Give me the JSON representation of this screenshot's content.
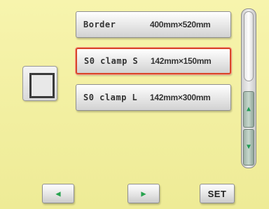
{
  "hoops": [
    {
      "name": "Border",
      "size": "400mm×520mm",
      "selected": false
    },
    {
      "name": "S0 clamp S",
      "size": "142mm×150mm",
      "selected": true
    },
    {
      "name": "S0 clamp L",
      "size": "142mm×300mm",
      "selected": false
    }
  ],
  "icons": {
    "hoop_preview": "hoop-square-icon",
    "scroll_up": "triangle-up-icon",
    "scroll_down": "triangle-down-icon",
    "prev": "triangle-left-icon",
    "next": "triangle-right-icon"
  },
  "glyphs": {
    "up": "▲",
    "down": "▼",
    "left": "◀",
    "right": "▶"
  },
  "buttons": {
    "set_label": "SET"
  },
  "colors": {
    "background": "#f3f0a0",
    "selected_border": "#d9462a",
    "arrow": "#27a34f"
  }
}
